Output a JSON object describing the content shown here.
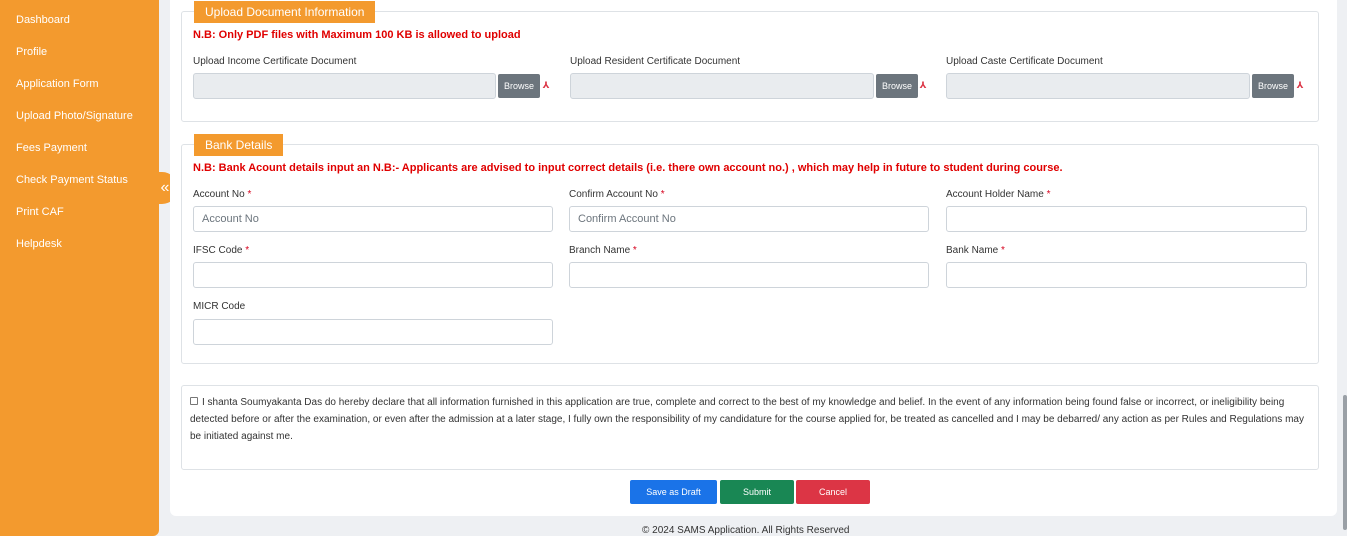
{
  "sidebar": {
    "items": [
      "Dashboard",
      "Profile",
      "Application Form",
      "Upload Photo/Signature",
      "Fees Payment",
      "Check Payment Status",
      "Print CAF",
      "Helpdesk"
    ],
    "toggle_icon": "«"
  },
  "upload": {
    "legend": "Upload Document Information",
    "note": "N.B: Only PDF files with Maximum 100 KB is allowed to upload",
    "fields": [
      {
        "label": "Upload Income Certificate Document",
        "button": "Browse"
      },
      {
        "label": "Upload Resident Certificate Document",
        "button": "Browse"
      },
      {
        "label": "Upload Caste Certificate Document",
        "button": "Browse"
      }
    ],
    "pdf_icon_glyph": "⅄"
  },
  "bank": {
    "legend": "Bank Details",
    "note": "N.B: Bank Acount details input an N.B:- Applicants are advised to input correct details (i.e. there own account no.) , which may help in future to student during course.",
    "required_mark": "*",
    "fields": [
      {
        "label": "Account No",
        "placeholder": "Account No"
      },
      {
        "label": "Confirm Account No",
        "placeholder": "Confirm Account No"
      },
      {
        "label": "Account Holder Name",
        "placeholder": ""
      },
      {
        "label": "IFSC Code",
        "placeholder": ""
      },
      {
        "label": "Branch Name",
        "placeholder": ""
      },
      {
        "label": "Bank Name",
        "placeholder": ""
      },
      {
        "label": "MICR Code",
        "placeholder": ""
      }
    ]
  },
  "declaration": {
    "text": "I shanta Soumyakanta Das do hereby declare that all information furnished in this application are true, complete and correct to the best of my knowledge and belief. In the event of any information being found false or incorrect, or ineligibility being detected before or after the examination, or even after the admission at a later stage, I fully own the responsibility of my candidature for the course applied for, be treated as cancelled and I may be debarred/ any action as per Rules and Regulations may be initiated against me."
  },
  "actions": {
    "save_draft": "Save as Draft",
    "submit": "Submit",
    "cancel": "Cancel",
    "colors": {
      "save_draft": "#1a73e8",
      "submit": "#198754",
      "cancel": "#dc3545"
    }
  },
  "footer": {
    "text": "© 2024 SAMS Application. All Rights Reserved"
  }
}
